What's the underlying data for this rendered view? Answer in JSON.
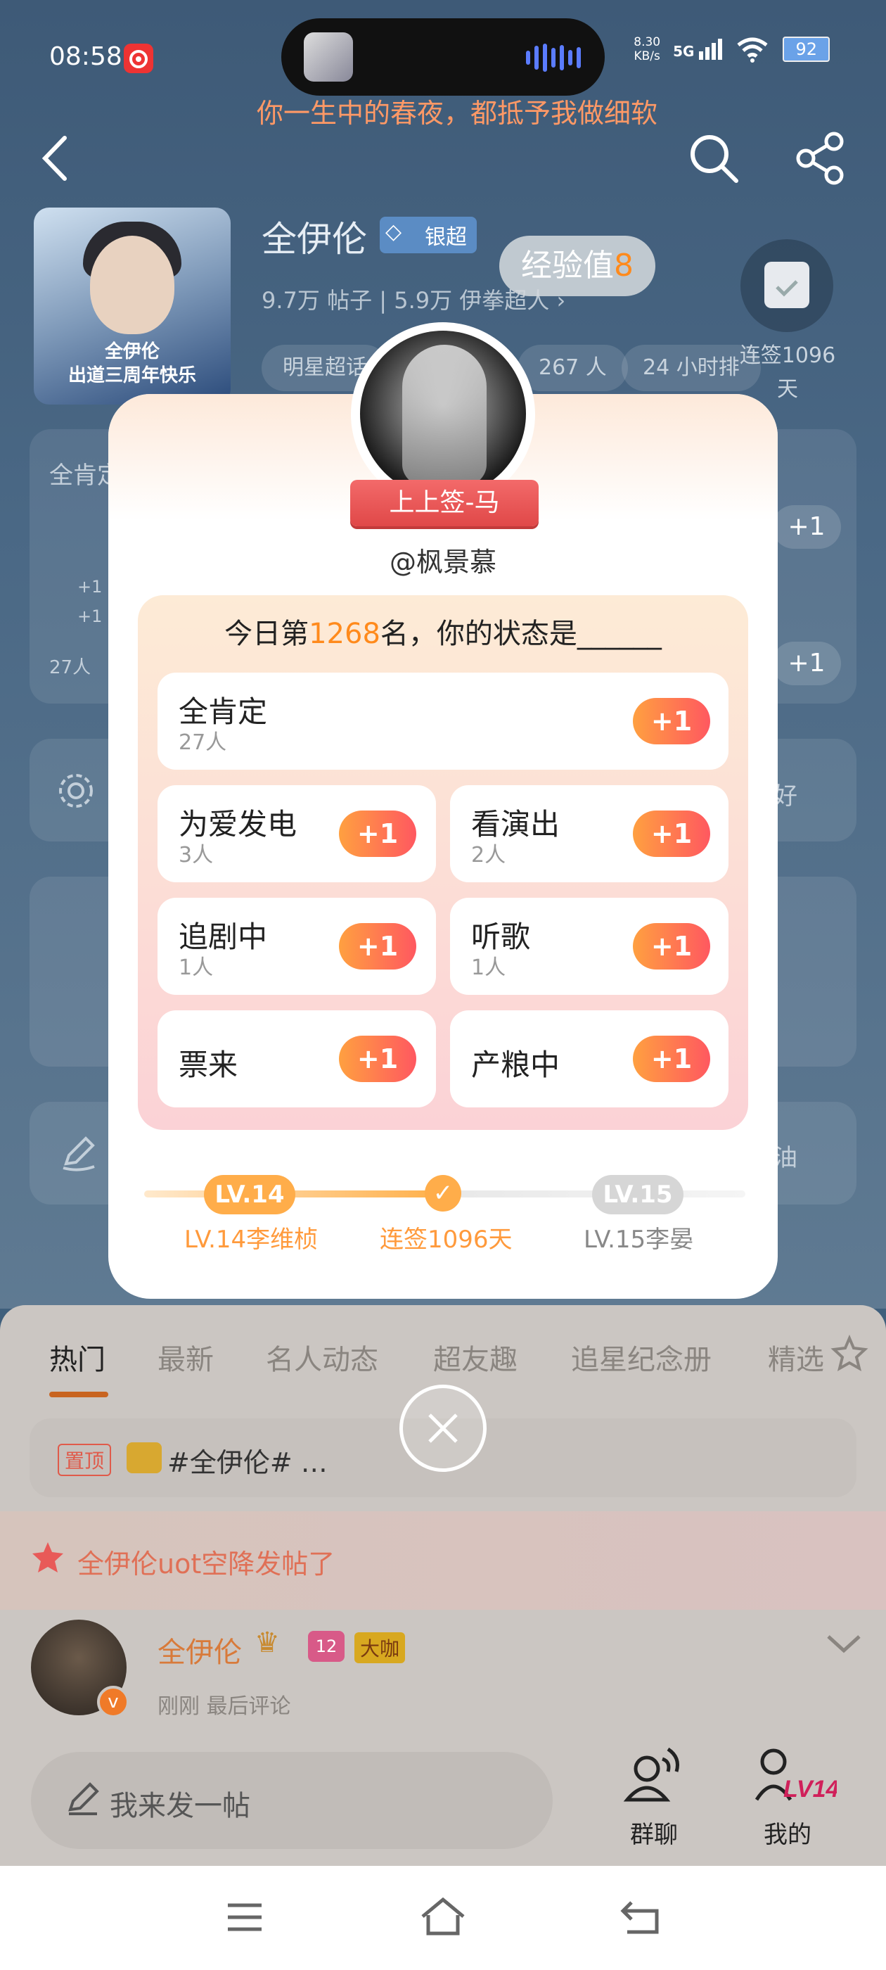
{
  "status_bar": {
    "time": "08:58",
    "net_speed_value": "8.30",
    "net_speed_unit": "KB/s",
    "signal": "5G",
    "battery": "92"
  },
  "now_playing": {
    "lyric": "你一生中的春夜，都抵予我做细软"
  },
  "header": {
    "name": "全伊伦",
    "badge": "银超",
    "posts_count": "9.7万",
    "posts_label": "帖子",
    "fans_count": "5.9万",
    "fans_label": "伊拳超人",
    "tags": [
      "明星超话",
      "267 人",
      "24 小时排"
    ],
    "avatar_caption": "全伊伦\n出道三周年快乐",
    "exp_bubble_prefix": "经验值",
    "exp_bubble_value": "8",
    "sign_label": "连签1096天"
  },
  "background_cards": {
    "card1_title": "全肯定",
    "card1_counts": [
      "+1",
      "+1"
    ],
    "card1_people": "27人",
    "plus": "+1",
    "card2_right": "好",
    "card3_right": "油"
  },
  "modal": {
    "ribbon": "上上签-马",
    "handle": "@枫景慕",
    "title_prefix": "今日第",
    "title_rank": "1268",
    "title_suffix": "名，你的状态是______",
    "plus_label": "+1",
    "options": [
      {
        "label": "全肯定",
        "count": "27人"
      },
      {
        "label": "为爱发电",
        "count": "3人"
      },
      {
        "label": "看演出",
        "count": "2人"
      },
      {
        "label": "追剧中",
        "count": "1人"
      },
      {
        "label": "听歌",
        "count": "1人"
      },
      {
        "label": "票来",
        "count": ""
      },
      {
        "label": "产粮中",
        "count": ""
      }
    ],
    "progress": {
      "current_level": "LV.14",
      "next_level": "LV.15",
      "current_label": "LV.14李维桢",
      "middle_label": "连签1096天",
      "next_label": "LV.15李晏"
    }
  },
  "tabs": [
    "热门",
    "最新",
    "名人动态",
    "超友趣",
    "追星纪念册",
    "精选"
  ],
  "pinned": {
    "badge": "置顶",
    "text": "#全伊伦# …"
  },
  "notice": {
    "text": "全伊伦uot空降发帖了"
  },
  "post": {
    "author": "全伊伦",
    "level_badge": "12",
    "role_badge": "大咖",
    "meta": "刚刚 最后评论"
  },
  "bottom": {
    "compose_placeholder": "我来发一帖",
    "group_chat": "群聊",
    "mine": "我的",
    "mine_level": "LV14"
  },
  "colors": {
    "accent_orange": "#ff8a1c",
    "plus_gradient_start": "#ffa040",
    "plus_gradient_end": "#ff5860",
    "ribbon_red": "#e04848",
    "notice_text": "#e07056"
  }
}
